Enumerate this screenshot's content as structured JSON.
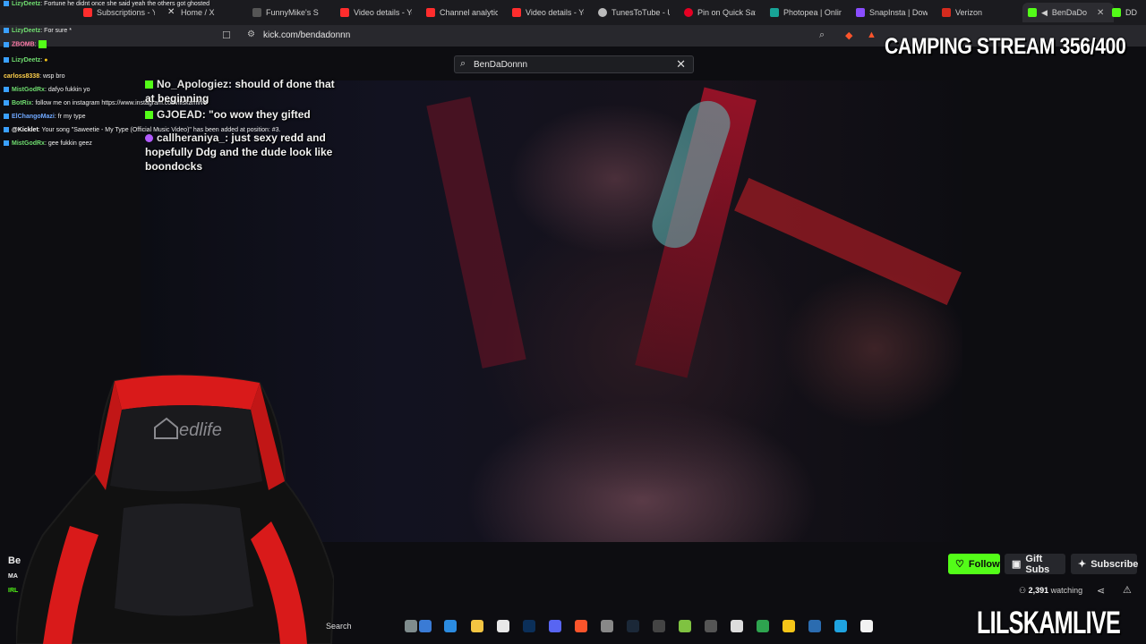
{
  "tabs": [
    {
      "label": "Subscriptions - Yo",
      "color": "#ff2d2d"
    },
    {
      "label": "Home / X",
      "color": "#dddddd"
    },
    {
      "label": "FunnyMike's S",
      "color": "#e0e0e0"
    },
    {
      "label": "Video details - Yo",
      "color": "#ff2d2d"
    },
    {
      "label": "Channel analytics",
      "color": "#ff2d2d"
    },
    {
      "label": "Video details - Yo",
      "color": "#ff2d2d"
    },
    {
      "label": "TunesToTube - Up",
      "color": "#e0e0e0"
    },
    {
      "label": "Pin on Quick Save",
      "color": "#e60023"
    },
    {
      "label": "Photopea | Onlin",
      "color": "#18a497"
    },
    {
      "label": "SnapInsta | Down",
      "color": "#8a4dff"
    },
    {
      "label": "Verizon",
      "color": "#d52b1e"
    },
    {
      "label": "BenDaDo",
      "color": "#53fc18"
    },
    {
      "label": "DD",
      "color": "#53fc18"
    }
  ],
  "address_bar": {
    "url": "kick.com/bendadonnn"
  },
  "search": {
    "value": "BenDaDonnn"
  },
  "overlay": {
    "title": "CAMPING STREAM 356/400",
    "brand": "LILSKAMLIVE",
    "chat": [
      {
        "user": "No_Apologiez",
        "text": "should of done that at beginning",
        "badge": "kick"
      },
      {
        "user": "GJOEAD",
        "text": "\"oo wow they gifted",
        "badge": "kick"
      },
      {
        "user": "callheraniya_",
        "text": "just sexy redd and hopefully Ddg and the dude look like boondocks",
        "badge": "purple"
      }
    ],
    "side_chat": [
      {
        "user": "LizyDeetz",
        "text": ": Fortune he didnt once she said yeah the others got ghosted"
      },
      {
        "user": "LizyDeetz",
        "text": ": For sure *"
      },
      {
        "user": "ZBOMB",
        "text": ":"
      },
      {
        "user": "LizyDeetz",
        "text": ":"
      },
      {
        "user": "carloss8338",
        "text": ": wsp bro"
      },
      {
        "user": "MistGodRx",
        "text": ": dafyo fukkin yo"
      },
      {
        "user": "BotRix",
        "text": ": follow me on instagram https://www.instagram.com/lilskamlive"
      },
      {
        "user": "ElChangoMazi",
        "text": ": fr my type"
      },
      {
        "user": "@Kicklet",
        "text": ": Your song \"Saweetie - My Type (Official Music Video)\" has been added at position: #3."
      },
      {
        "user": "MistGodRx",
        "text": ": gee fukkin geez"
      }
    ]
  },
  "channel": {
    "follow_label": "Follow",
    "gift_label": "Gift Subs",
    "subscribe_label": "Subscribe",
    "viewers": "2,391",
    "watching_label": "watching",
    "name_fragment": "Be",
    "sub_fragment": "MA",
    "tag_fragment": "IRL"
  },
  "taskbar": {
    "search_label": "Search"
  },
  "colors": {
    "kick_green": "#53fc18",
    "chair_red": "#d91a1a",
    "page_bg": "#0d0d11"
  }
}
